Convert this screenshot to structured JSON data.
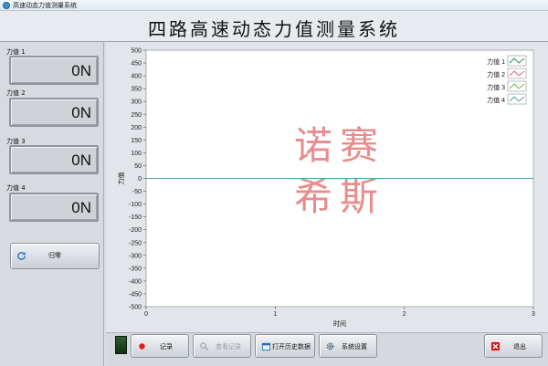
{
  "window": {
    "title": "高速动态力值测量系统"
  },
  "header": {
    "title": "四路高速动态力值测量系统"
  },
  "channels": [
    {
      "label": "力值 1",
      "value": "0N"
    },
    {
      "label": "力值 2",
      "value": "0N"
    },
    {
      "label": "力值 3",
      "value": "0N"
    },
    {
      "label": "力值 4",
      "value": "0N"
    }
  ],
  "zero_button": {
    "label": "归零",
    "icon": "refresh-icon"
  },
  "chart_data": {
    "type": "line",
    "xlabel": "时间",
    "ylabel": "力值",
    "xlim": [
      0,
      3
    ],
    "ylim": [
      -500,
      500
    ],
    "x_ticks": [
      "0",
      "1",
      "2",
      "3"
    ],
    "y_ticks": [
      "500",
      "450",
      "400",
      "350",
      "300",
      "250",
      "200",
      "150",
      "100",
      "50",
      "0",
      "-50",
      "-100",
      "-150",
      "-200",
      "-250",
      "-300",
      "-350",
      "-400",
      "-450",
      "-500"
    ],
    "grid": false,
    "legend_position": "top-right",
    "series": [
      {
        "name": "力值 1",
        "color": "#2e8b57",
        "x": [
          0,
          3
        ],
        "y": [
          0,
          0
        ]
      },
      {
        "name": "力值 2",
        "color": "#e06666",
        "x": [
          0,
          3
        ],
        "y": [
          0,
          0
        ]
      },
      {
        "name": "力值 3",
        "color": "#6abf3a",
        "x": [
          0,
          3
        ],
        "y": [
          0,
          0
        ]
      },
      {
        "name": "力值 4",
        "color": "#5aa0a8",
        "x": [
          0,
          3
        ],
        "y": [
          0,
          0
        ]
      }
    ],
    "watermark": [
      "诺赛",
      "希斯"
    ],
    "watermark_color": "#e88c8c"
  },
  "toolbar": {
    "record_label": "记录",
    "view_records_label": "查看记录",
    "open_history_label": "打开历史数据",
    "settings_label": "系统设置",
    "exit_label": "退出"
  }
}
